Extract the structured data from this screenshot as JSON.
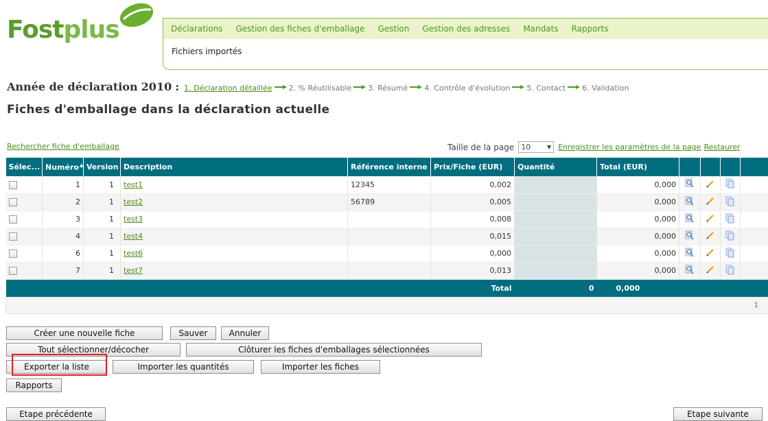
{
  "logo": {
    "part1": "Fost",
    "part2": "plus"
  },
  "nav": {
    "items": [
      "Déclarations",
      "Gestion des fiches d'emballage",
      "Gestion",
      "Gestion des adresses",
      "Mandats",
      "Rapports"
    ],
    "sub": "Fichiers importés"
  },
  "steps": {
    "label": "Année de déclaration",
    "year": "2010",
    "colon": ":",
    "items": [
      "1. Déclaration détaillée",
      "2. % Réutilisable",
      "3. Résumé",
      "4. Contrôle d'évolution",
      "5. Contact",
      "6. Validation"
    ]
  },
  "title": "Fiches d'emballage dans la déclaration actuelle",
  "toolbar": {
    "search_link": "Rechercher fiche d'emballage",
    "page_size_label": "Taille de la page",
    "page_size_value": "10",
    "save_settings": "Enregistrer les paramètres de la page",
    "restore": "Restaurer"
  },
  "grid": {
    "headers": [
      "Sélec...",
      "Numéro",
      "Version",
      "Description",
      "Référence interne",
      "Prix/Fiche (EUR)",
      "Quantité",
      "Total (EUR)"
    ],
    "rows": [
      {
        "numero": "1",
        "version": "1",
        "description": "test1",
        "reference": "12345",
        "prix": "0,002",
        "quantite": "",
        "total": "0,000"
      },
      {
        "numero": "2",
        "version": "1",
        "description": "test2",
        "reference": "56789",
        "prix": "0,005",
        "quantite": "",
        "total": "0,000"
      },
      {
        "numero": "3",
        "version": "1",
        "description": "test3",
        "reference": "",
        "prix": "0,008",
        "quantite": "",
        "total": "0,000"
      },
      {
        "numero": "4",
        "version": "1",
        "description": "test4",
        "reference": "",
        "prix": "0,015",
        "quantite": "",
        "total": "0,000"
      },
      {
        "numero": "6",
        "version": "1",
        "description": "test6",
        "reference": "",
        "prix": "0,000",
        "quantite": "",
        "total": "0,000"
      },
      {
        "numero": "7",
        "version": "1",
        "description": "test7",
        "reference": "",
        "prix": "0,013",
        "quantite": "",
        "total": "0,000"
      }
    ],
    "total_label": "Total",
    "total_quantity": "0",
    "total_amount": "0,000",
    "page_number": "1",
    "icons": [
      "view-icon",
      "edit-icon",
      "copy-icon"
    ]
  },
  "buttons": {
    "create": "Créer une nouvelle fiche",
    "save": "Sauver",
    "cancel": "Annuler",
    "select_all": "Tout sélectionner/décocher",
    "close_selected": "Clôturer les fiches d'emballages sélectionnées",
    "export": "Exporter la liste",
    "import_quantities": "Importer les quantités",
    "import_sheets": "Importer les fiches",
    "reports": "Rapports",
    "previous": "Etape précédente",
    "next": "Etape suivante"
  },
  "colors": {
    "brand_green": "#5a9e2b",
    "header_teal": "#006e7f",
    "nav_bg": "#eaf3c9",
    "highlight_red": "#e02020"
  }
}
